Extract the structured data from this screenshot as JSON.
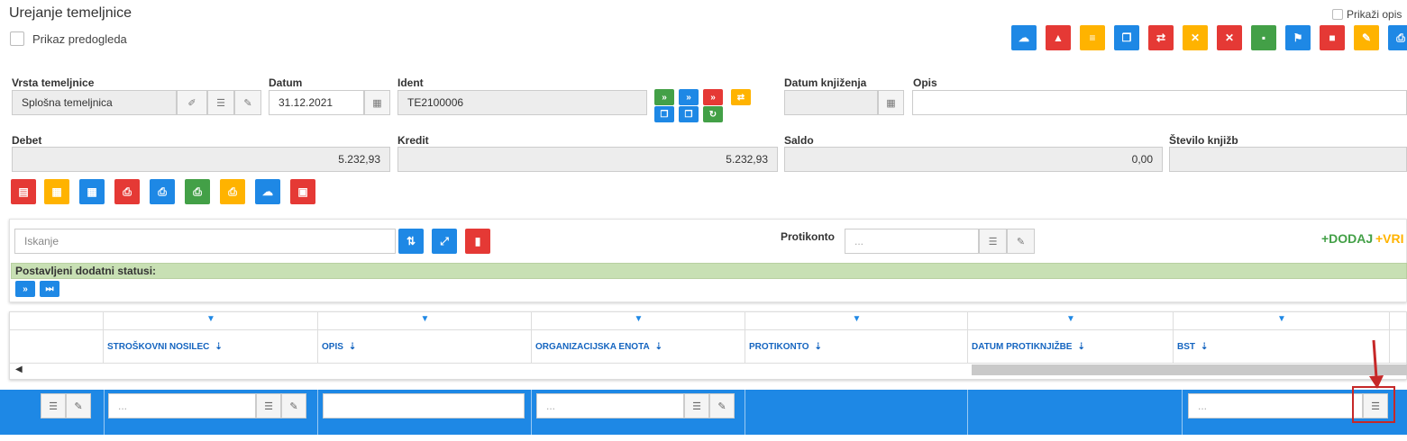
{
  "page": {
    "title": "Urejanje temeljnice",
    "preview_label": "Prikaz predogleda",
    "show_desc_label": "Prikaži opis"
  },
  "toolbar_top": [
    {
      "icon": "cloud-icon",
      "color": "#1e88e5",
      "glyph": "☁"
    },
    {
      "icon": "warning-icon",
      "color": "#e53935",
      "glyph": "▲"
    },
    {
      "icon": "list-icon",
      "color": "#ffb300",
      "glyph": "≡"
    },
    {
      "icon": "copy-icon",
      "color": "#1e88e5",
      "glyph": "❐"
    },
    {
      "icon": "retweet-icon",
      "color": "#e53935",
      "glyph": "⇄"
    },
    {
      "icon": "eraser-icon",
      "color": "#ffb300",
      "glyph": "✕"
    },
    {
      "icon": "eraser-icon",
      "color": "#e53935",
      "glyph": "✕"
    },
    {
      "icon": "save-icon",
      "color": "#43a047",
      "glyph": "▪"
    },
    {
      "icon": "flag-icon",
      "color": "#1e88e5",
      "glyph": "⚑"
    },
    {
      "icon": "lock-icon",
      "color": "#e53935",
      "glyph": "■"
    },
    {
      "icon": "edit-icon",
      "color": "#ffb300",
      "glyph": "✎"
    },
    {
      "icon": "print-icon",
      "color": "#1e88e5",
      "glyph": "⎙"
    }
  ],
  "form": {
    "vrsta_label": "Vrsta temeljnice",
    "vrsta_value": "Splošna temeljnica",
    "datum_label": "Datum",
    "datum_value": "31.12.2021",
    "ident_label": "Ident",
    "ident_value": "TE2100006",
    "datum_knjizenja_label": "Datum knjiženja",
    "datum_knjizenja_value": "",
    "opis_label": "Opis",
    "opis_value": "",
    "debet_label": "Debet",
    "debet_value": "5.232,93",
    "kredit_label": "Kredit",
    "kredit_value": "5.232,93",
    "saldo_label": "Saldo",
    "saldo_value": "0,00",
    "stevilo_label": "Število knjižb",
    "stevilo_value": ""
  },
  "ident_buttons": [
    {
      "icon": "fast-forward-icon",
      "color": "#43a047",
      "glyph": "»"
    },
    {
      "icon": "fast-forward-icon",
      "color": "#1e88e5",
      "glyph": "»"
    },
    {
      "icon": "fast-forward-icon",
      "color": "#e53935",
      "glyph": "»"
    },
    {
      "icon": "retweet-icon",
      "color": "#ffb300",
      "glyph": "⇄"
    },
    {
      "icon": "copy-icon",
      "color": "#1e88e5",
      "glyph": "❐"
    },
    {
      "icon": "copy-icon",
      "color": "#1e88e5",
      "glyph": "❐"
    },
    {
      "icon": "refresh-icon",
      "color": "#43a047",
      "glyph": "↻"
    }
  ],
  "toolbar_mid": [
    {
      "icon": "document-icon",
      "color": "#e53935",
      "glyph": "▤"
    },
    {
      "icon": "table-icon",
      "color": "#ffb300",
      "glyph": "▦"
    },
    {
      "icon": "table-icon",
      "color": "#1e88e5",
      "glyph": "▦"
    },
    {
      "icon": "print-icon",
      "color": "#e53935",
      "glyph": "⎙"
    },
    {
      "icon": "print-icon",
      "color": "#1e88e5",
      "glyph": "⎙"
    },
    {
      "icon": "print-icon",
      "color": "#43a047",
      "glyph": "⎙"
    },
    {
      "icon": "print-icon",
      "color": "#ffb300",
      "glyph": "⎙"
    },
    {
      "icon": "cloud-icon",
      "color": "#1e88e5",
      "glyph": "☁"
    },
    {
      "icon": "pdf-icon",
      "color": "#e53935",
      "glyph": "▣"
    }
  ],
  "search": {
    "placeholder": "Iskanje",
    "protikonto_label": "Protikonto",
    "protikonto_placeholder": "...",
    "add_label": "+DODAJ",
    "more_label": "+VRI"
  },
  "status_bar": {
    "label": "Postavljeni dodatni statusi:"
  },
  "table": {
    "headers": [
      "STROŠKOVNI NOSILEC",
      "OPIS",
      "ORGANIZACIJSKA ENOTA",
      "PROTIKONTO",
      "DATUM PROTIKNJIŽBE",
      "BST"
    ],
    "filter_placeholder": "..."
  },
  "colors": {
    "accent": "#1e88e5",
    "danger": "#e53935",
    "warning": "#ffb300",
    "success": "#43a047",
    "status_bg": "#c8e0b4",
    "annotation": "#c62828"
  }
}
